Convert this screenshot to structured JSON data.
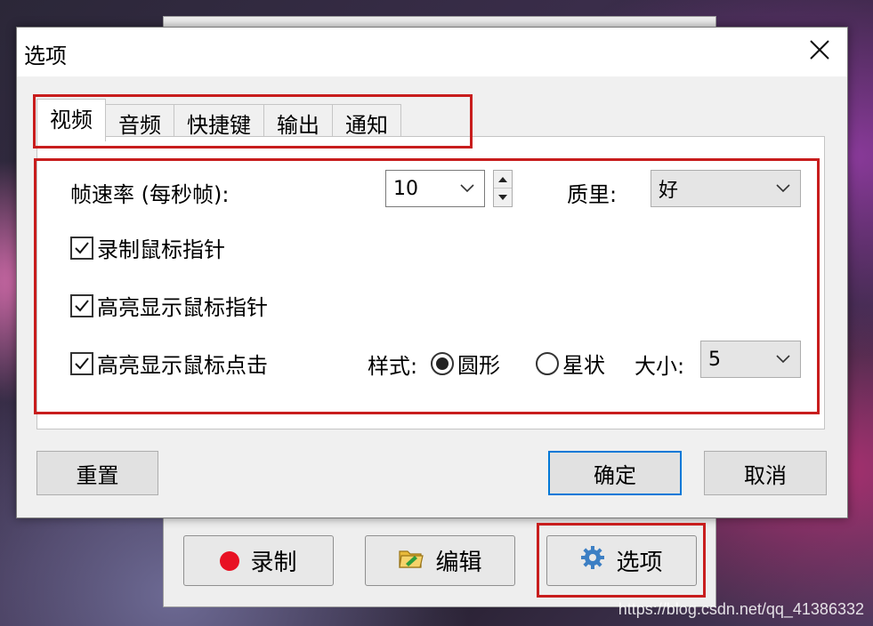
{
  "dialog": {
    "title": "选项",
    "tabs": [
      {
        "label": "视频",
        "active": true
      },
      {
        "label": "音频"
      },
      {
        "label": "快捷键"
      },
      {
        "label": "输出"
      },
      {
        "label": "通知"
      }
    ],
    "video": {
      "framerate_label": "帧速率 (每秒帧):",
      "framerate_value": "10",
      "quality_label": "质里:",
      "quality_value": "好",
      "record_cursor_label": "录制鼠标指针",
      "highlight_cursor_label": "高亮显示鼠标指针",
      "highlight_click_label": "高亮显示鼠标点击",
      "style_label": "样式:",
      "style_options": [
        "圆形",
        "星状"
      ],
      "style_selected": "圆形",
      "size_label": "大小:",
      "size_value": "5"
    },
    "reset_label": "重置",
    "ok_label": "确定",
    "cancel_label": "取消"
  },
  "main_toolbar": {
    "record_label": "录制",
    "edit_label": "编辑",
    "options_label": "选项"
  },
  "watermark": "https://blog.csdn.net/qq_41386332",
  "colors": {
    "highlight_box": "#c81d1d",
    "record_dot": "#e81123",
    "default_button_border": "#0078d7"
  }
}
